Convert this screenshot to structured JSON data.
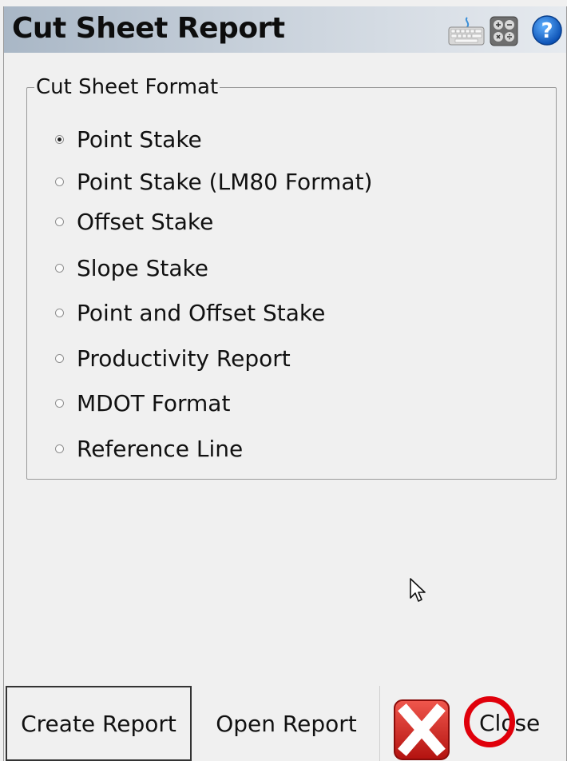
{
  "window": {
    "title": "Cut Sheet Report",
    "title_icons": [
      "keyboard-icon",
      "calculator-icon",
      "help-icon"
    ]
  },
  "format_group": {
    "legend": "Cut Sheet Format",
    "selected": "Point Stake",
    "options": [
      {
        "label": "Point Stake",
        "checked": true
      },
      {
        "label": "Point Stake (LM80 Format)",
        "checked": false
      },
      {
        "label": "Offset Stake",
        "checked": false
      },
      {
        "label": "Slope Stake",
        "checked": false
      },
      {
        "label": "Point and Offset Stake",
        "checked": false
      },
      {
        "label": "Productivity Report",
        "checked": false
      },
      {
        "label": "MDOT Format",
        "checked": false
      },
      {
        "label": "Reference Line",
        "checked": false
      }
    ]
  },
  "footer": {
    "create_label": "Create Report",
    "open_label": "Open Report",
    "close_label": "Close"
  },
  "colors": {
    "titlebar_start": "#a9b7c6",
    "titlebar_end": "#e6eaef",
    "background": "#f0f0f0",
    "close_icon_red": "#d8201c",
    "annotation_circle": "#e0000b"
  }
}
